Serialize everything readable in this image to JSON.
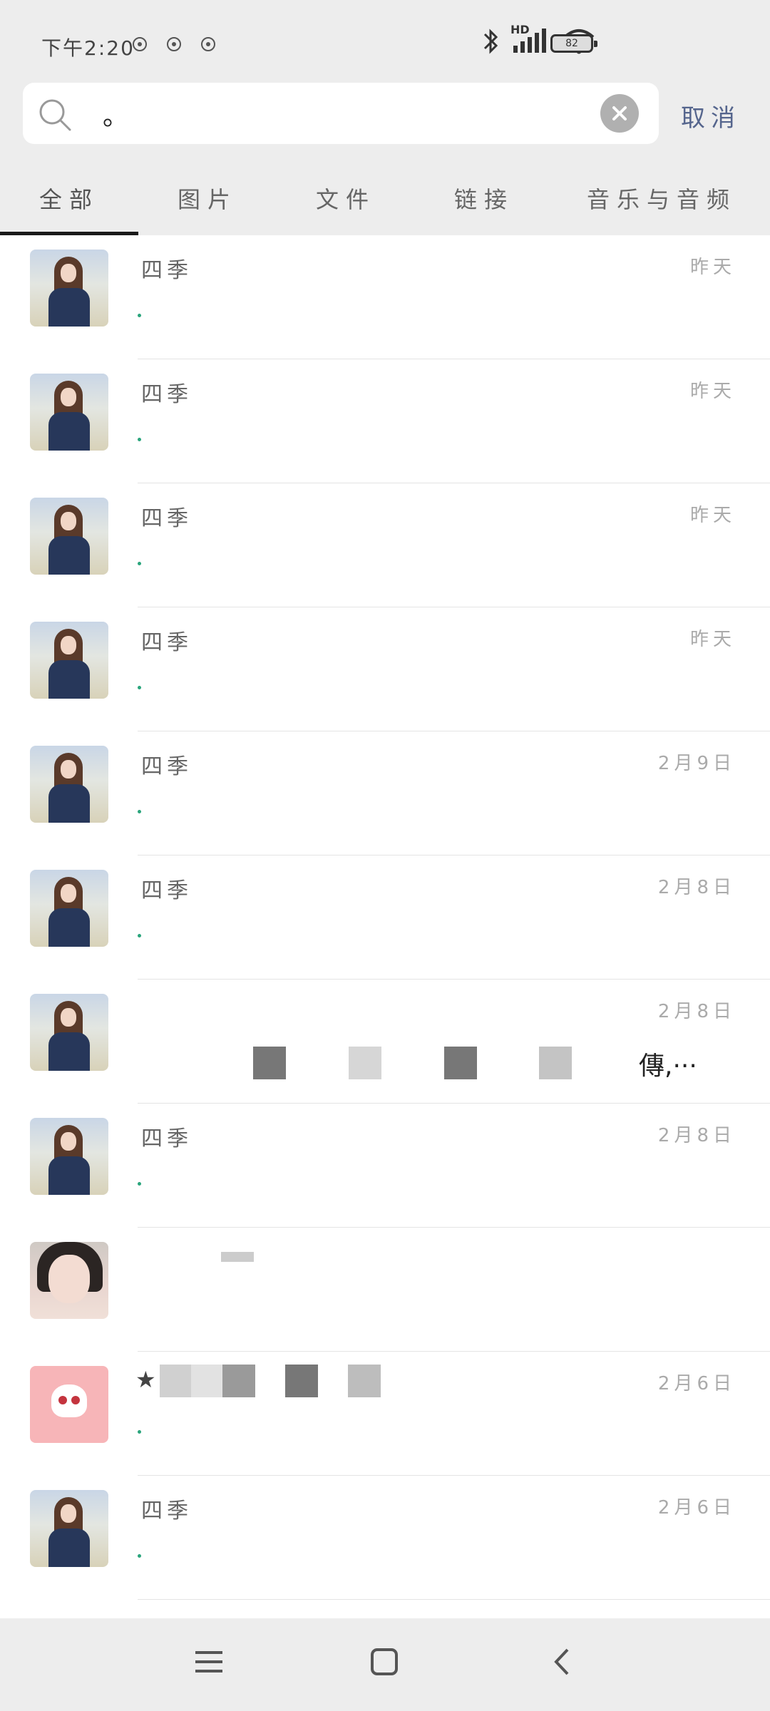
{
  "status": {
    "time": "下午2:20",
    "network": "HD",
    "battery": "82"
  },
  "search": {
    "value": "。",
    "placeholder": "",
    "cancel_label": "取消"
  },
  "tabs": [
    {
      "label": "全部",
      "active": true
    },
    {
      "label": "图片",
      "active": false
    },
    {
      "label": "文件",
      "active": false
    },
    {
      "label": "链接",
      "active": false
    },
    {
      "label": "音乐与音频",
      "active": false
    }
  ],
  "results": [
    {
      "name": "四季",
      "time": "昨天",
      "avatar": "girl"
    },
    {
      "name": "四季",
      "time": "昨天",
      "avatar": "girl"
    },
    {
      "name": "四季",
      "time": "昨天",
      "avatar": "girl"
    },
    {
      "name": "四季",
      "time": "昨天",
      "avatar": "girl"
    },
    {
      "name": "四季",
      "time": "2月9日",
      "avatar": "girl"
    },
    {
      "name": "四季",
      "time": "2月8日",
      "avatar": "girl"
    },
    {
      "name": "",
      "time": "2月8日",
      "avatar": "girl",
      "snippet": "傳,···"
    },
    {
      "name": "四季",
      "time": "2月8日",
      "avatar": "girl"
    },
    {
      "name": "",
      "time": "",
      "avatar": "selfie"
    },
    {
      "name": "★",
      "time": "2月6日",
      "avatar": "anime"
    },
    {
      "name": "四季",
      "time": "2月6日",
      "avatar": "girl"
    }
  ],
  "colors": {
    "accent_green": "#2aa57c",
    "cancel_blue": "#55658d",
    "bar_bg": "#ededed"
  }
}
